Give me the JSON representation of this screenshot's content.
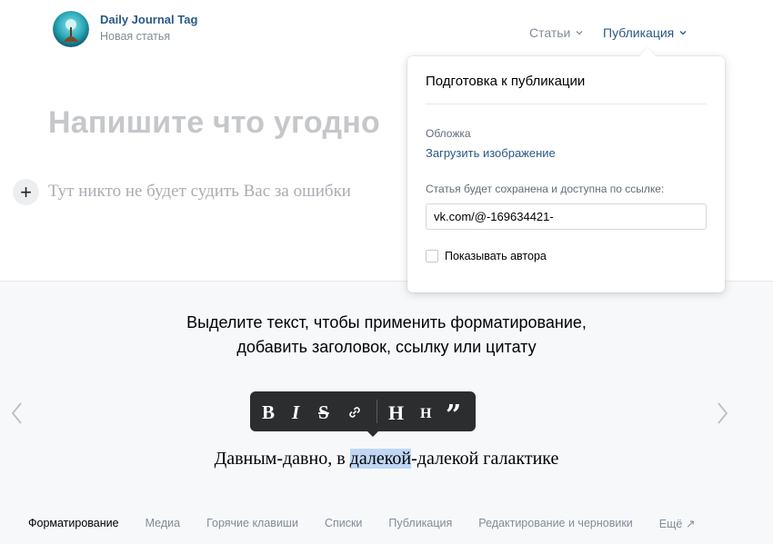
{
  "header": {
    "brand_name": "Daily Journal Tag",
    "brand_subtitle": "Новая статья",
    "nav": {
      "articles": "Статьи",
      "publish": "Публикация"
    }
  },
  "editor": {
    "title_placeholder": "Напишите что угодно",
    "body_placeholder": "Тут никто не будет судить Вас за ошибки",
    "add_symbol": "+"
  },
  "publish_dropdown": {
    "title": "Подготовка к публикации",
    "cover_label": "Обложка",
    "upload_link": "Загрузить изображение",
    "saved_label": "Статья будет сохранена и доступна по ссылке:",
    "link_value": "vk.com/@-169634421-",
    "show_author_label": "Показывать автора",
    "show_author_checked": false
  },
  "help": {
    "line1": "Выделите текст, чтобы применить форматирование,",
    "line2": "добавить заголовок, ссылку или цитату",
    "toolbar": {
      "bold": "B",
      "italic": "I",
      "strike": "S",
      "h1": "H",
      "h2": "H",
      "quote": "”"
    },
    "sample_before": "Давным-давно, в ",
    "sample_highlight": "далекой",
    "sample_after": "-далекой галактике",
    "tabs": [
      {
        "label": "Форматирование",
        "active": true
      },
      {
        "label": "Медиа",
        "active": false
      },
      {
        "label": "Горячие клавиши",
        "active": false
      },
      {
        "label": "Списки",
        "active": false
      },
      {
        "label": "Публикация",
        "active": false
      },
      {
        "label": "Редактирование и черновики",
        "active": false
      },
      {
        "label": "Ещё ↗",
        "active": false
      }
    ]
  },
  "colors": {
    "link_blue": "#2a5885",
    "muted": "#818c99",
    "toolbar_bg": "#2c2d2e",
    "highlight": "#bfd7f5"
  }
}
